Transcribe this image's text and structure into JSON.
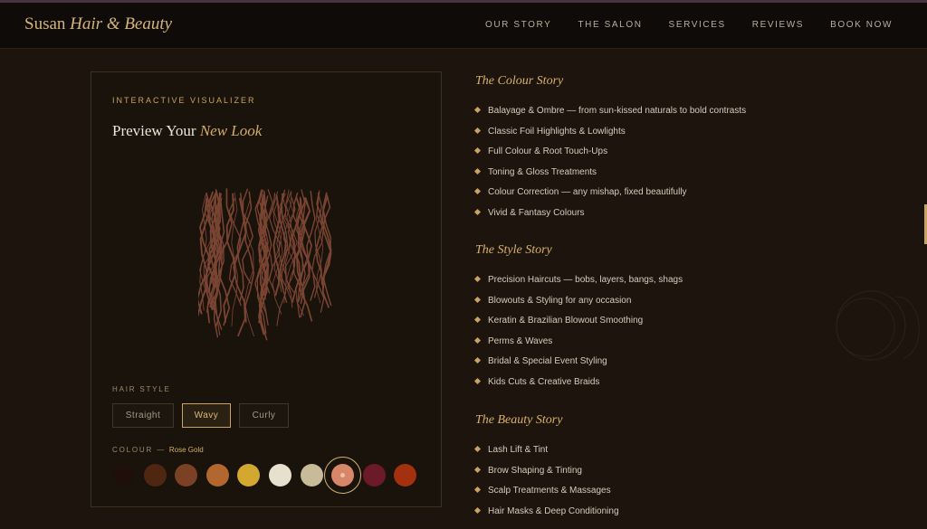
{
  "brand": {
    "name": "Susan",
    "italic": "Hair & Beauty"
  },
  "nav": [
    "OUR STORY",
    "THE SALON",
    "SERVICES",
    "REVIEWS",
    "BOOK NOW"
  ],
  "visualizer": {
    "eyebrow": "INTERACTIVE VISUALIZER",
    "title": "Preview Your",
    "title_italic": "New Look",
    "hair_style_label": "HAIR STYLE",
    "styles": [
      "Straight",
      "Wavy",
      "Curly"
    ],
    "selected_style": "Wavy",
    "colour_label": "COLOUR",
    "colour_sep": "—",
    "selected_colour": "Rose Gold",
    "swatches": [
      {
        "name": "Jet Black",
        "color": "#1f0f0b"
      },
      {
        "name": "Dark Brown",
        "color": "#4f2610"
      },
      {
        "name": "Chestnut",
        "color": "#7a4124"
      },
      {
        "name": "Caramel",
        "color": "#b1672e"
      },
      {
        "name": "Golden Blonde",
        "color": "#d3a831"
      },
      {
        "name": "Platinum",
        "color": "#e8e0cf"
      },
      {
        "name": "Ash Blonde",
        "color": "#c8bb9a"
      },
      {
        "name": "Rose Gold",
        "color": "#d8866a"
      },
      {
        "name": "Burgundy",
        "color": "#6d1a28"
      },
      {
        "name": "Copper Red",
        "color": "#a3300e"
      }
    ],
    "hair_color": "#7a4432"
  },
  "sections": [
    {
      "title": "The Colour Story",
      "items": [
        "Balayage & Ombre — from sun-kissed naturals to bold contrasts",
        "Classic Foil Highlights & Lowlights",
        "Full Colour & Root Touch-Ups",
        "Toning & Gloss Treatments",
        "Colour Correction — any mishap, fixed beautifully",
        "Vivid & Fantasy Colours"
      ]
    },
    {
      "title": "The Style Story",
      "items": [
        "Precision Haircuts — bobs, layers, bangs, shags",
        "Blowouts & Styling for any occasion",
        "Keratin & Brazilian Blowout Smoothing",
        "Perms & Waves",
        "Bridal & Special Event Styling",
        "Kids Cuts & Creative Braids"
      ]
    },
    {
      "title": "The Beauty Story",
      "items": [
        "Lash Lift & Tint",
        "Brow Shaping & Tinting",
        "Scalp Treatments & Massages",
        "Hair Masks & Deep Conditioning"
      ]
    }
  ]
}
